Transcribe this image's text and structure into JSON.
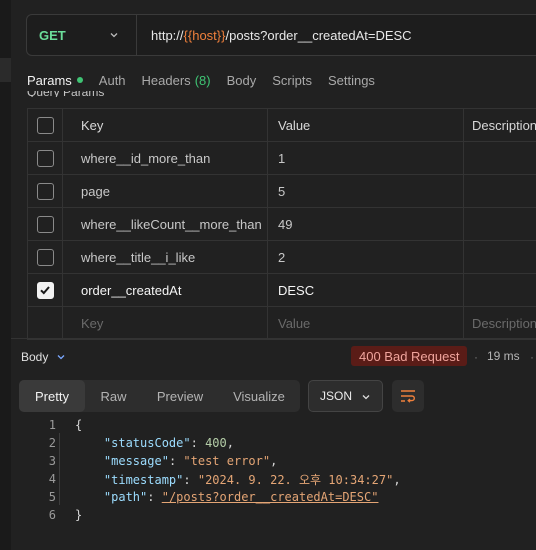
{
  "request": {
    "method": "GET",
    "url_prefix": "http://",
    "url_variable": "{{host}}",
    "url_suffix": "/posts?order__createdAt=DESC"
  },
  "tabs": [
    {
      "label": "Params",
      "active": true,
      "indicator": "green-dot"
    },
    {
      "label": "Auth"
    },
    {
      "label": "Headers",
      "count": "(8)"
    },
    {
      "label": "Body"
    },
    {
      "label": "Scripts"
    },
    {
      "label": "Settings"
    }
  ],
  "section_title_partial": "Query Params",
  "params_table": {
    "columns": [
      "Key",
      "Value",
      "Description"
    ],
    "rows": [
      {
        "checked": false,
        "key": "where__id_more_than",
        "value": "1"
      },
      {
        "checked": false,
        "key": "page",
        "value": "5"
      },
      {
        "checked": false,
        "key": "where__likeCount__more_than",
        "value": "49"
      },
      {
        "checked": false,
        "key": "where__title__i_like",
        "value": "2"
      },
      {
        "checked": true,
        "key": "order__createdAt",
        "value": "DESC"
      }
    ],
    "placeholder": {
      "key": "Key",
      "value": "Value",
      "description": "Description"
    }
  },
  "response": {
    "section_label": "Body",
    "status": "400 Bad Request",
    "separator": "·",
    "time": "19 ms",
    "view_tabs": [
      "Pretty",
      "Raw",
      "Preview",
      "Visualize"
    ],
    "active_view": "Pretty",
    "format": "JSON",
    "lines": [
      "1",
      "2",
      "3",
      "4",
      "5",
      "6"
    ],
    "body": {
      "open": "{",
      "close": "}",
      "statusCode_key": "\"statusCode\"",
      "statusCode_val": "400",
      "message_key": "\"message\"",
      "message_val": "\"test error\"",
      "timestamp_key": "\"timestamp\"",
      "timestamp_val": "\"2024. 9. 22. 오후 10:34:27\"",
      "path_key": "\"path\"",
      "path_val": "\"/posts?order__createdAt=DESC\""
    }
  },
  "colors": {
    "method": "#6bdd9a",
    "variable": "#f0803c",
    "status_bg": "#5a1c17",
    "status_text": "#f0a49c",
    "active_dot": "#3fc474"
  }
}
